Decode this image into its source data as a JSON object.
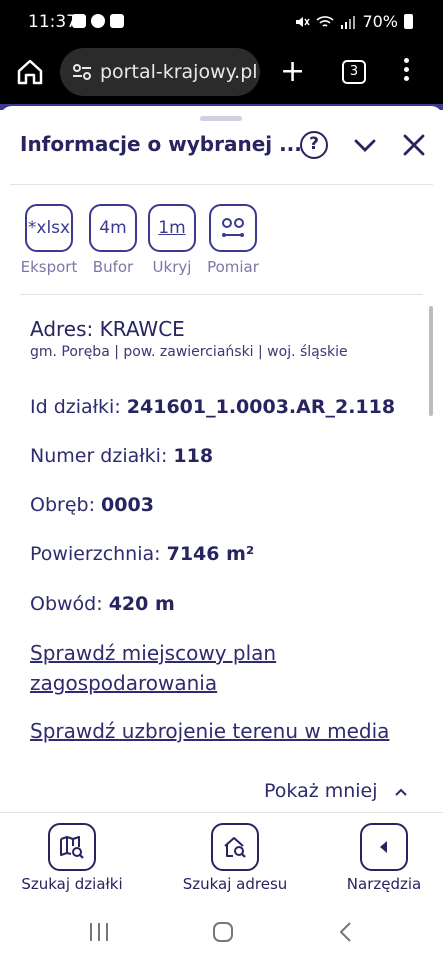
{
  "status": {
    "time": "11:37",
    "battery": "70%"
  },
  "browser": {
    "url": "portal-krajowy.pl",
    "tab_count": "3",
    "new_tab_label": "+"
  },
  "panel": {
    "title": "Informacje o wybranej ...",
    "help_label": "?"
  },
  "tools": [
    {
      "icon_text": "*xlsx",
      "label": "Eksport"
    },
    {
      "icon_text": "4m",
      "label": "Bufor"
    },
    {
      "icon_text": "1m",
      "label": "Ukryj"
    },
    {
      "icon_text": "",
      "label": "Pomiar"
    }
  ],
  "parcel": {
    "address": "Adres: KRAWCE",
    "region": "gm. Poręba | pow. zawierciański | woj. śląskie",
    "id_label": "Id działki:",
    "id_value": "241601_1.0003.AR_2.118",
    "number_label": "Numer działki:",
    "number_value": "118",
    "precinct_label": "Obręb:",
    "precinct_value": "0003",
    "area_label": "Powierzchnia:",
    "area_value": "7146 m²",
    "perimeter_label": "Obwód:",
    "perimeter_value": "420 m"
  },
  "links": {
    "plan": "Sprawdź miejscowy plan zagospodarowania",
    "media": "Sprawdź uzbrojenie terenu w media"
  },
  "show_less": "Pokaż mniej",
  "bottom": [
    {
      "label": "Szukaj działki"
    },
    {
      "label": "Szukaj adresu"
    },
    {
      "label": "Narzędzia"
    }
  ]
}
